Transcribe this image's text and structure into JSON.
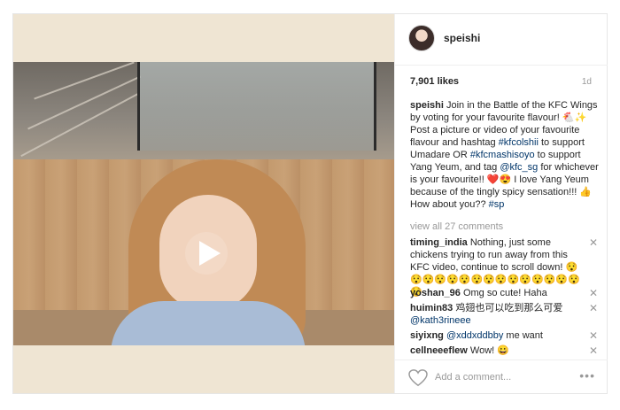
{
  "post": {
    "username": "speishi",
    "likes": "7,901 likes",
    "age": "1d",
    "caption_user": "speishi",
    "caption_text_1": "Join in the Battle of the KFC Wings by voting for your favourite flavour! 🐔✨ Post a picture or video of your favourite flavour and hashtag ",
    "tag_kfcolshii": "#kfcolshii",
    "caption_text_2": " to support Umadare OR ",
    "tag_kfcmashisoyo": "#kfcmashisoyo",
    "caption_text_3": " to support Yang Yeum, and tag ",
    "mention_kfc_sg": "@kfc_sg",
    "caption_text_4": " for whichever is your favourite!! ❤️😍 I love Yang Yeum because of the tingly spicy sensation!!! 👍 How about you?? ",
    "tag_sp": "#sp",
    "view_all": "view all 27 comments"
  },
  "comments": [
    {
      "user": "timing_india",
      "text": "Nothing, just some chickens trying to run away from this KFC video, continue to scroll down! 😯😯😯😯😯😯😯😯😯😯😯😯😯😯😯😯"
    },
    {
      "user": "yoshan_96",
      "text": "Omg so cute! Haha"
    },
    {
      "user": "huimin83",
      "text": "鸡翅也可以吃到那么可爱",
      "mention": "@kath3rineee"
    },
    {
      "user": "siyixng",
      "text": "me want",
      "mention": "@xddxddbby"
    },
    {
      "user": "cellneeeflew",
      "text": "Wow! 😀"
    }
  ],
  "footer": {
    "add_comment_placeholder": "Add a comment...",
    "more_label": "•••"
  },
  "icons": {
    "close": "✕"
  }
}
